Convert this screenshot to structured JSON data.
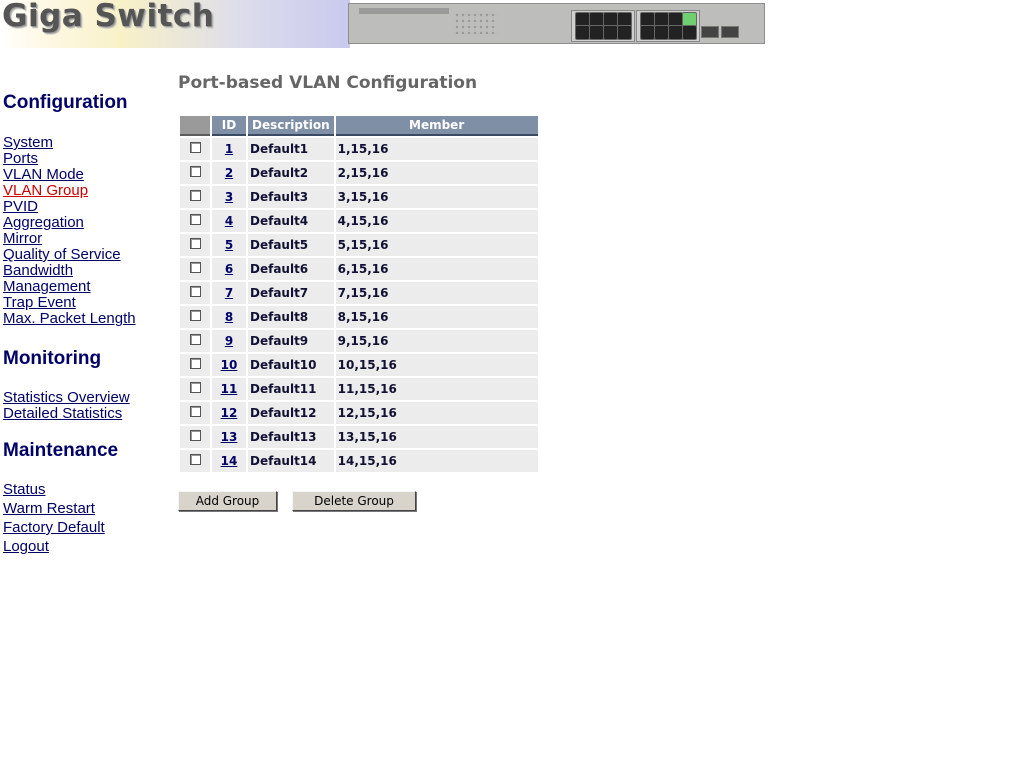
{
  "header": {
    "logo_text": "Giga Switch"
  },
  "sidebar": {
    "configuration": {
      "heading": "Configuration",
      "items": [
        "System",
        "Ports",
        "VLAN Mode",
        "VLAN Group",
        "PVID",
        "Aggregation",
        "Mirror",
        "Quality of Service",
        "Bandwidth",
        "Management",
        "Trap Event",
        "Max. Packet Length"
      ],
      "active": "VLAN Group"
    },
    "monitoring": {
      "heading": "Monitoring",
      "items": [
        "Statistics Overview",
        "Detailed Statistics"
      ]
    },
    "maintenance": {
      "heading": "Maintenance",
      "items": [
        "Status",
        "Warm Restart",
        "Factory Default",
        "Logout"
      ]
    }
  },
  "main": {
    "title": "Port-based VLAN Configuration",
    "table": {
      "headers": [
        "",
        "ID",
        "Description",
        "Member"
      ],
      "rows": [
        {
          "id": "1",
          "description": "Default1",
          "member": "1,15,16"
        },
        {
          "id": "2",
          "description": "Default2",
          "member": "2,15,16"
        },
        {
          "id": "3",
          "description": "Default3",
          "member": "3,15,16"
        },
        {
          "id": "4",
          "description": "Default4",
          "member": "4,15,16"
        },
        {
          "id": "5",
          "description": "Default5",
          "member": "5,15,16"
        },
        {
          "id": "6",
          "description": "Default6",
          "member": "6,15,16"
        },
        {
          "id": "7",
          "description": "Default7",
          "member": "7,15,16"
        },
        {
          "id": "8",
          "description": "Default8",
          "member": "8,15,16"
        },
        {
          "id": "9",
          "description": "Default9",
          "member": "9,15,16"
        },
        {
          "id": "10",
          "description": "Default10",
          "member": "10,15,16"
        },
        {
          "id": "11",
          "description": "Default11",
          "member": "11,15,16"
        },
        {
          "id": "12",
          "description": "Default12",
          "member": "12,15,16"
        },
        {
          "id": "13",
          "description": "Default13",
          "member": "13,15,16"
        },
        {
          "id": "14",
          "description": "Default14",
          "member": "14,15,16"
        }
      ]
    },
    "buttons": {
      "add": "Add Group",
      "delete": "Delete Group"
    }
  },
  "colors": {
    "nav": "#000066",
    "active_nav": "#cc0000",
    "header_bg": "#7f8fa6",
    "row_bg": "#ececec"
  }
}
